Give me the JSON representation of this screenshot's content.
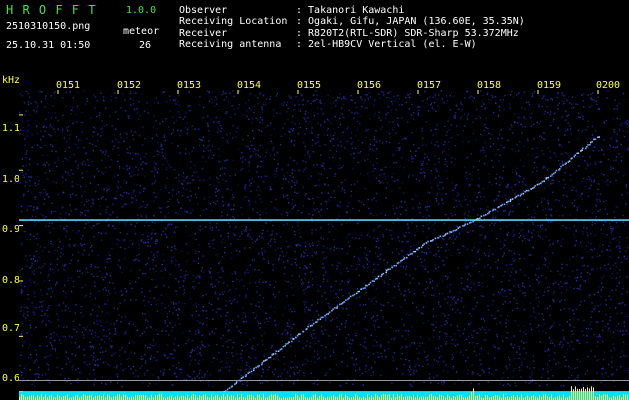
{
  "app": {
    "name": "H R O F F T",
    "version": "1.0.0",
    "filename": "2510310150.png",
    "datetime": "25.10.31 01:50",
    "meteor_label": "meteor",
    "meteor_count": "26"
  },
  "info": {
    "rows": [
      {
        "label": "Observer",
        "value": ": Takanori Kawachi"
      },
      {
        "label": "Receiving Location",
        "value": ": Ogaki, Gifu, JAPAN (136.60E, 35.35N)"
      },
      {
        "label": "Receiver",
        "value": ": R820T2(RTL-SDR) SDR-Sharp 53.372MHz"
      },
      {
        "label": "Receiving antenna",
        "value": ": 2el-HB9CV Vertical (el. E-W)"
      }
    ]
  },
  "axis": {
    "unit": "kHz",
    "x_ticks": [
      "0151",
      "0152",
      "0153",
      "0154",
      "0155",
      "0156",
      "0157",
      "0158",
      "0159",
      "0200"
    ],
    "y_ticks": [
      "1.1",
      "1.0",
      "0.9",
      "0.8",
      "0.7",
      "0.6"
    ]
  },
  "colors": {
    "background": "#000000",
    "noise": "#1a2a9a",
    "carrier": "#4fd8ff",
    "meteor_trace": "#6aa8ff",
    "header_green": "#46e046",
    "tick_yellow": "#ffff40",
    "baseline_cyan": "#00e0ff"
  },
  "chart_data": {
    "type": "heatmap",
    "x_ticks": [
      "0151",
      "0152",
      "0153",
      "0154",
      "0155",
      "0156",
      "0157",
      "0158",
      "0159",
      "0200"
    ],
    "y_ticks": [
      1.1,
      1.0,
      0.9,
      0.8,
      0.7,
      0.6
    ],
    "ylabel": "kHz",
    "ylim": [
      0.585,
      1.145
    ],
    "carrier_khz": 0.91,
    "reference_lines_khz": [
      0.62,
      0.6
    ],
    "meteor_trace": [
      {
        "time": "01:53:20",
        "khz": 0.585
      },
      {
        "time": "01:55:00",
        "khz": 0.72
      },
      {
        "time": "01:57:00",
        "khz": 0.87
      },
      {
        "time": "01:57:50",
        "khz": 0.91
      },
      {
        "time": "01:59:00",
        "khz": 0.98
      },
      {
        "time": "02:00:00",
        "khz": 1.065
      }
    ]
  }
}
